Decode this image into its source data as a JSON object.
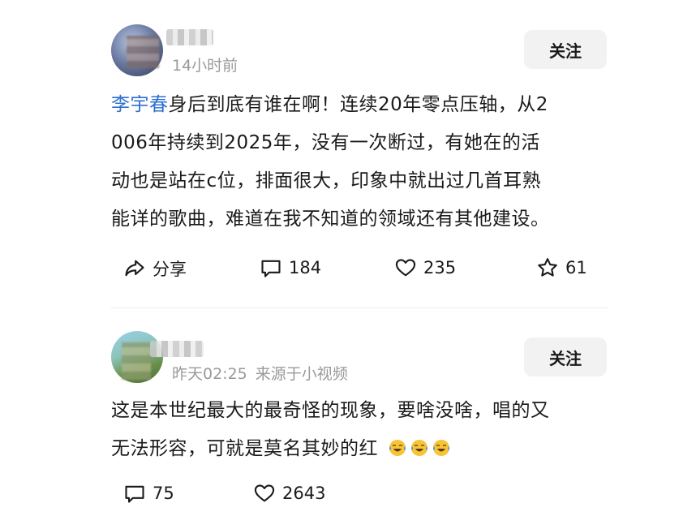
{
  "posts": [
    {
      "meta_time": "14小时前",
      "follow_label": "关注",
      "mention": "李宇春",
      "content_lines": [
        "身后到底有谁在啊！连续20年零点压轴，从2",
        "006年持续到2025年，没有一次断过，有她在的活",
        "动也是站在c位，排面很大，印象中就出过几首耳熟",
        "能详的歌曲，难道在我不知道的领域还有其他建设。"
      ],
      "actions": {
        "share_label": "分享",
        "comment_count": "184",
        "like_count": "235",
        "favorite_count": "61"
      }
    },
    {
      "meta_time": "昨天02:25",
      "meta_source": "来源于小视频",
      "follow_label": "关注",
      "content_lines": [
        "这是本世纪最大的最奇怪的现象，要啥没啥，唱的又",
        "无法形容，可就是莫名其妙的红"
      ],
      "emoji_icons": [
        "crying-laughing-icon",
        "crying-laughing-icon",
        "crying-laughing-icon"
      ],
      "actions": {
        "comment_count": "75",
        "like_count": "2643"
      }
    }
  ],
  "colors": {
    "mention": "#2f6fd1",
    "meta_text": "#9a9a9a",
    "follow_bg": "#f2f2f2",
    "emoji_face": "#f7c435",
    "emoji_tear": "#3d9be9"
  }
}
